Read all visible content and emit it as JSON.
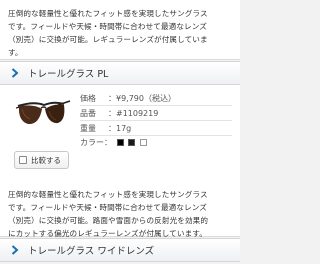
{
  "top_description": {
    "lines": [
      "圧倒的な軽量性と優れたフィット感を実現したサングラス",
      "です。フィールドや天候・時間帯に合わせて最適なレンズ",
      "（別売）に交換が可能。レギュラーレンズが付属していま",
      "す。"
    ]
  },
  "product": {
    "name": "トレールグラス PL",
    "price_label": "価格",
    "price_value": "：¥9,790（税込）",
    "sku_label": "品番",
    "sku_value": "：#1109219",
    "weight_label": "重量",
    "weight_value": "：17g",
    "color_label": "カラー：",
    "swatch_colors": [
      "#000000",
      "#1a1a1a",
      "#ffffff"
    ],
    "compare_label": "比較する"
  },
  "second_description": {
    "lines": [
      "圧倒的な軽量性と優れたフィット感を実現したサングラス",
      "です。フィールドや天候・時間帯に合わせて最適なレンズ",
      "（別売）に交換が可能。路面や雪面からの反射光を効果的",
      "にカットする偏光のレギュラーレンズが付属しています。"
    ]
  },
  "next_product": {
    "name": "トレールグラス ワイドレンズ"
  },
  "colors": {
    "accent": "#1a6fb0"
  }
}
